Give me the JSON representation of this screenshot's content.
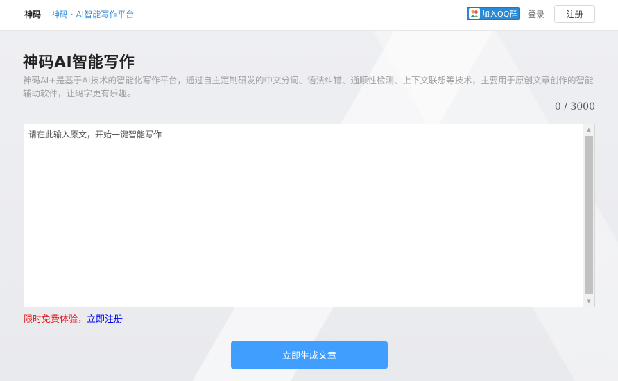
{
  "header": {
    "logo_text": "神码",
    "site_title": "神码 · AI智能写作平台",
    "qq_button": "加入QQ群",
    "qq_icon": "qq-group-icon",
    "login": "登录",
    "register": "注册"
  },
  "main": {
    "title": "神码AI智能写作",
    "description": "神码AI+是基于AI技术的智能化写作平台，通过自主定制研发的中文分词、语法纠错、通顺性检测、上下文联想等技术，主要用于原创文章创作的智能辅助软件，让码字更有乐趣。",
    "char_count": "0",
    "char_separator": "/",
    "char_limit": "3000",
    "editor_placeholder": "请在此输入原文，开始一键智能写作",
    "editor_value": "",
    "promo_text": "限时免费体验，",
    "promo_link": "立即注册",
    "generate_button": "立即生成文章"
  },
  "colors": {
    "accent": "#409eff",
    "link": "#3b8fd6",
    "promo": "#e02020",
    "qq_button": "#2b8ad6"
  }
}
